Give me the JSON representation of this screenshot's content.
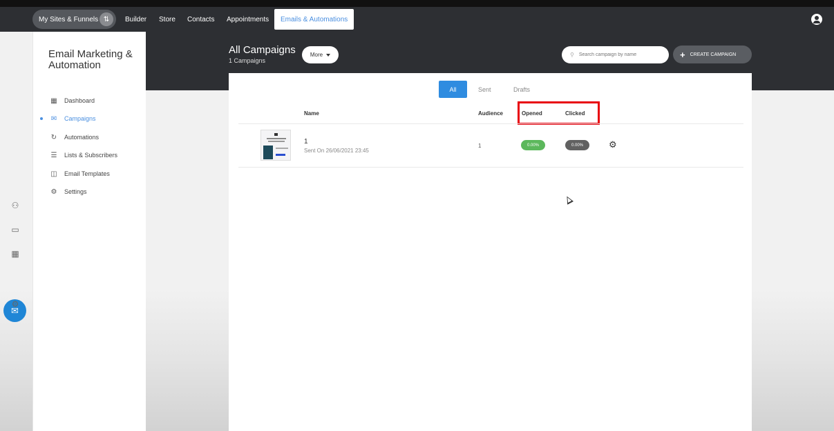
{
  "nav": {
    "sites_label": "My Sites & Funnels",
    "swap_glyph": "⇅",
    "links": [
      "Builder",
      "Store",
      "Contacts",
      "Appointments",
      "Emails & Automations"
    ]
  },
  "sidebar": {
    "title": "Email Marketing & Automation",
    "items": [
      {
        "label": "Dashboard",
        "icon": "dashboard-icon",
        "glyph": "▦"
      },
      {
        "label": "Campaigns",
        "icon": "envelope-icon",
        "glyph": "✉"
      },
      {
        "label": "Automations",
        "icon": "refresh-icon",
        "glyph": "↻"
      },
      {
        "label": "Lists & Subscribers",
        "icon": "list-icon",
        "glyph": "☰"
      },
      {
        "label": "Email Templates",
        "icon": "template-icon",
        "glyph": "◫"
      },
      {
        "label": "Settings",
        "icon": "gear-icon",
        "glyph": "⚙"
      }
    ]
  },
  "rail": {
    "icons": [
      {
        "name": "users-icon",
        "glyph": "⚇"
      },
      {
        "name": "inbox-icon",
        "glyph": "▭"
      },
      {
        "name": "calendar-icon",
        "glyph": "▦"
      },
      {
        "name": "mail-icon",
        "glyph": "✉"
      },
      {
        "name": "gear-icon",
        "glyph": "⚙"
      }
    ]
  },
  "header": {
    "title": "All Campaigns",
    "subtitle": "1 Campaigns",
    "more_label": "More",
    "search_placeholder": "Search campaign by name",
    "search_glyph": "⚲",
    "create_label": "CREATE CAMPAIGN",
    "create_glyph": "+"
  },
  "tabs": [
    "All",
    "Sent",
    "Drafts"
  ],
  "table": {
    "columns": [
      "Name",
      "Audience",
      "Opened",
      "Clicked"
    ],
    "rows": [
      {
        "name": "1",
        "sent": "Sent On 26/06/2021 23:45",
        "audience": "1",
        "opened": "0.00%",
        "clicked": "0.00%",
        "gear_glyph": "⚙"
      }
    ]
  },
  "colors": {
    "accent": "#2f8ce0",
    "opened_badge": "#5cb85c",
    "clicked_badge": "#616161",
    "highlight": "#e8000b"
  }
}
